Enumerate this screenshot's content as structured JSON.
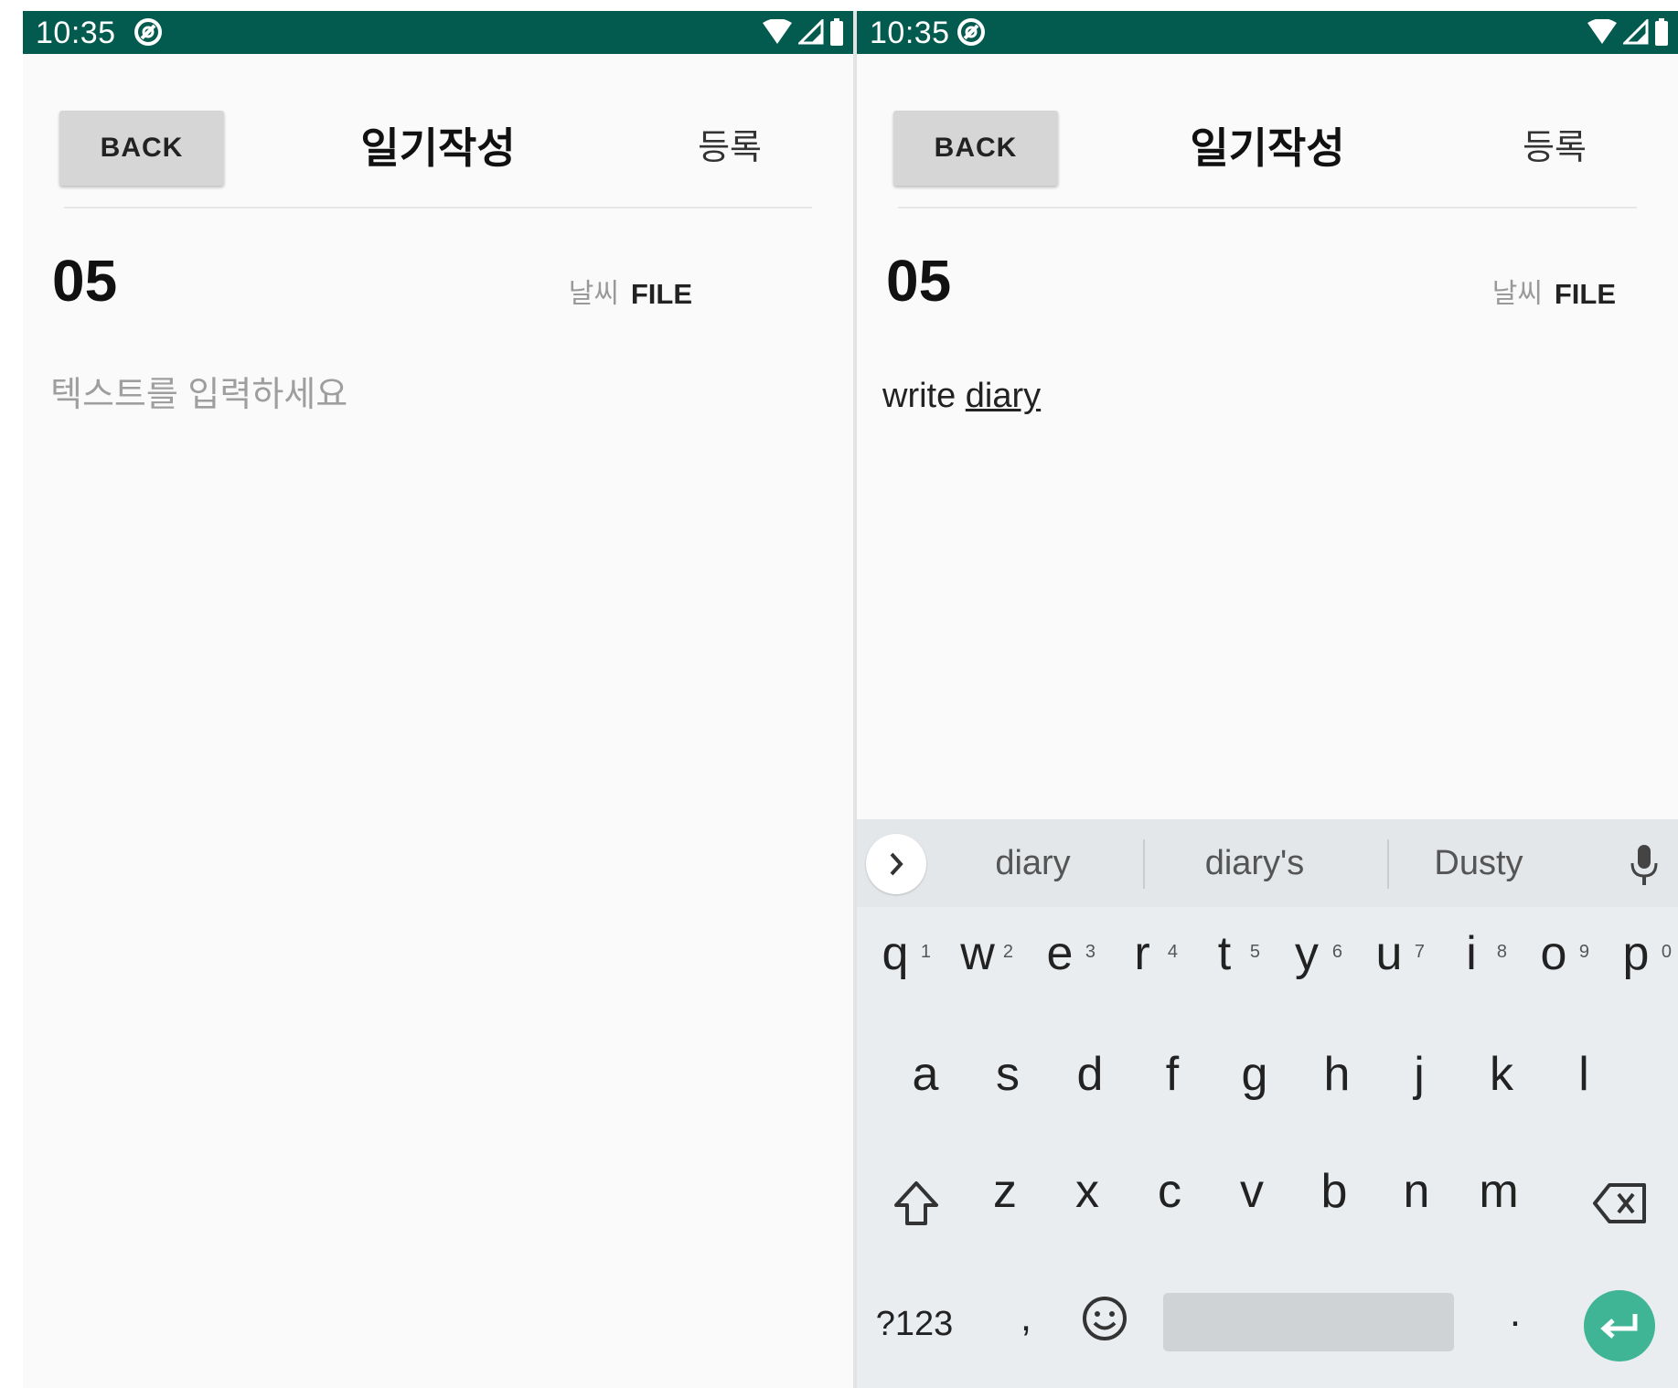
{
  "colors": {
    "status_bar": "#035b4f",
    "enter_key": "#3fb595",
    "background": "#fafafa",
    "keyboard": "#eaedf0"
  },
  "left": {
    "status": {
      "time": "10:35"
    },
    "toolbar": {
      "back_label": "BACK",
      "title": "일기작성",
      "register_label": "등록"
    },
    "date": {
      "day": "05"
    },
    "actions": {
      "weather_label": "날씨",
      "file_label": "FILE"
    },
    "editor": {
      "placeholder": "텍스트를 입력하세요"
    }
  },
  "right": {
    "status": {
      "time": "10:35"
    },
    "toolbar": {
      "back_label": "BACK",
      "title": "일기작성",
      "register_label": "등록"
    },
    "date": {
      "day": "05"
    },
    "actions": {
      "weather_label": "날씨",
      "file_label": "FILE"
    },
    "editor": {
      "text_plain": "write ",
      "text_underlined": "diary"
    },
    "keyboard": {
      "suggestions": [
        "diary",
        "diary's",
        "Dusty"
      ],
      "row1": [
        {
          "k": "q",
          "h": "1"
        },
        {
          "k": "w",
          "h": "2"
        },
        {
          "k": "e",
          "h": "3"
        },
        {
          "k": "r",
          "h": "4"
        },
        {
          "k": "t",
          "h": "5"
        },
        {
          "k": "y",
          "h": "6"
        },
        {
          "k": "u",
          "h": "7"
        },
        {
          "k": "i",
          "h": "8"
        },
        {
          "k": "o",
          "h": "9"
        },
        {
          "k": "p",
          "h": "0"
        }
      ],
      "row2": [
        "a",
        "s",
        "d",
        "f",
        "g",
        "h",
        "j",
        "k",
        "l"
      ],
      "row3": [
        "z",
        "x",
        "c",
        "v",
        "b",
        "n",
        "m"
      ],
      "symbols_label": "?123",
      "comma": ",",
      "period": "."
    }
  }
}
